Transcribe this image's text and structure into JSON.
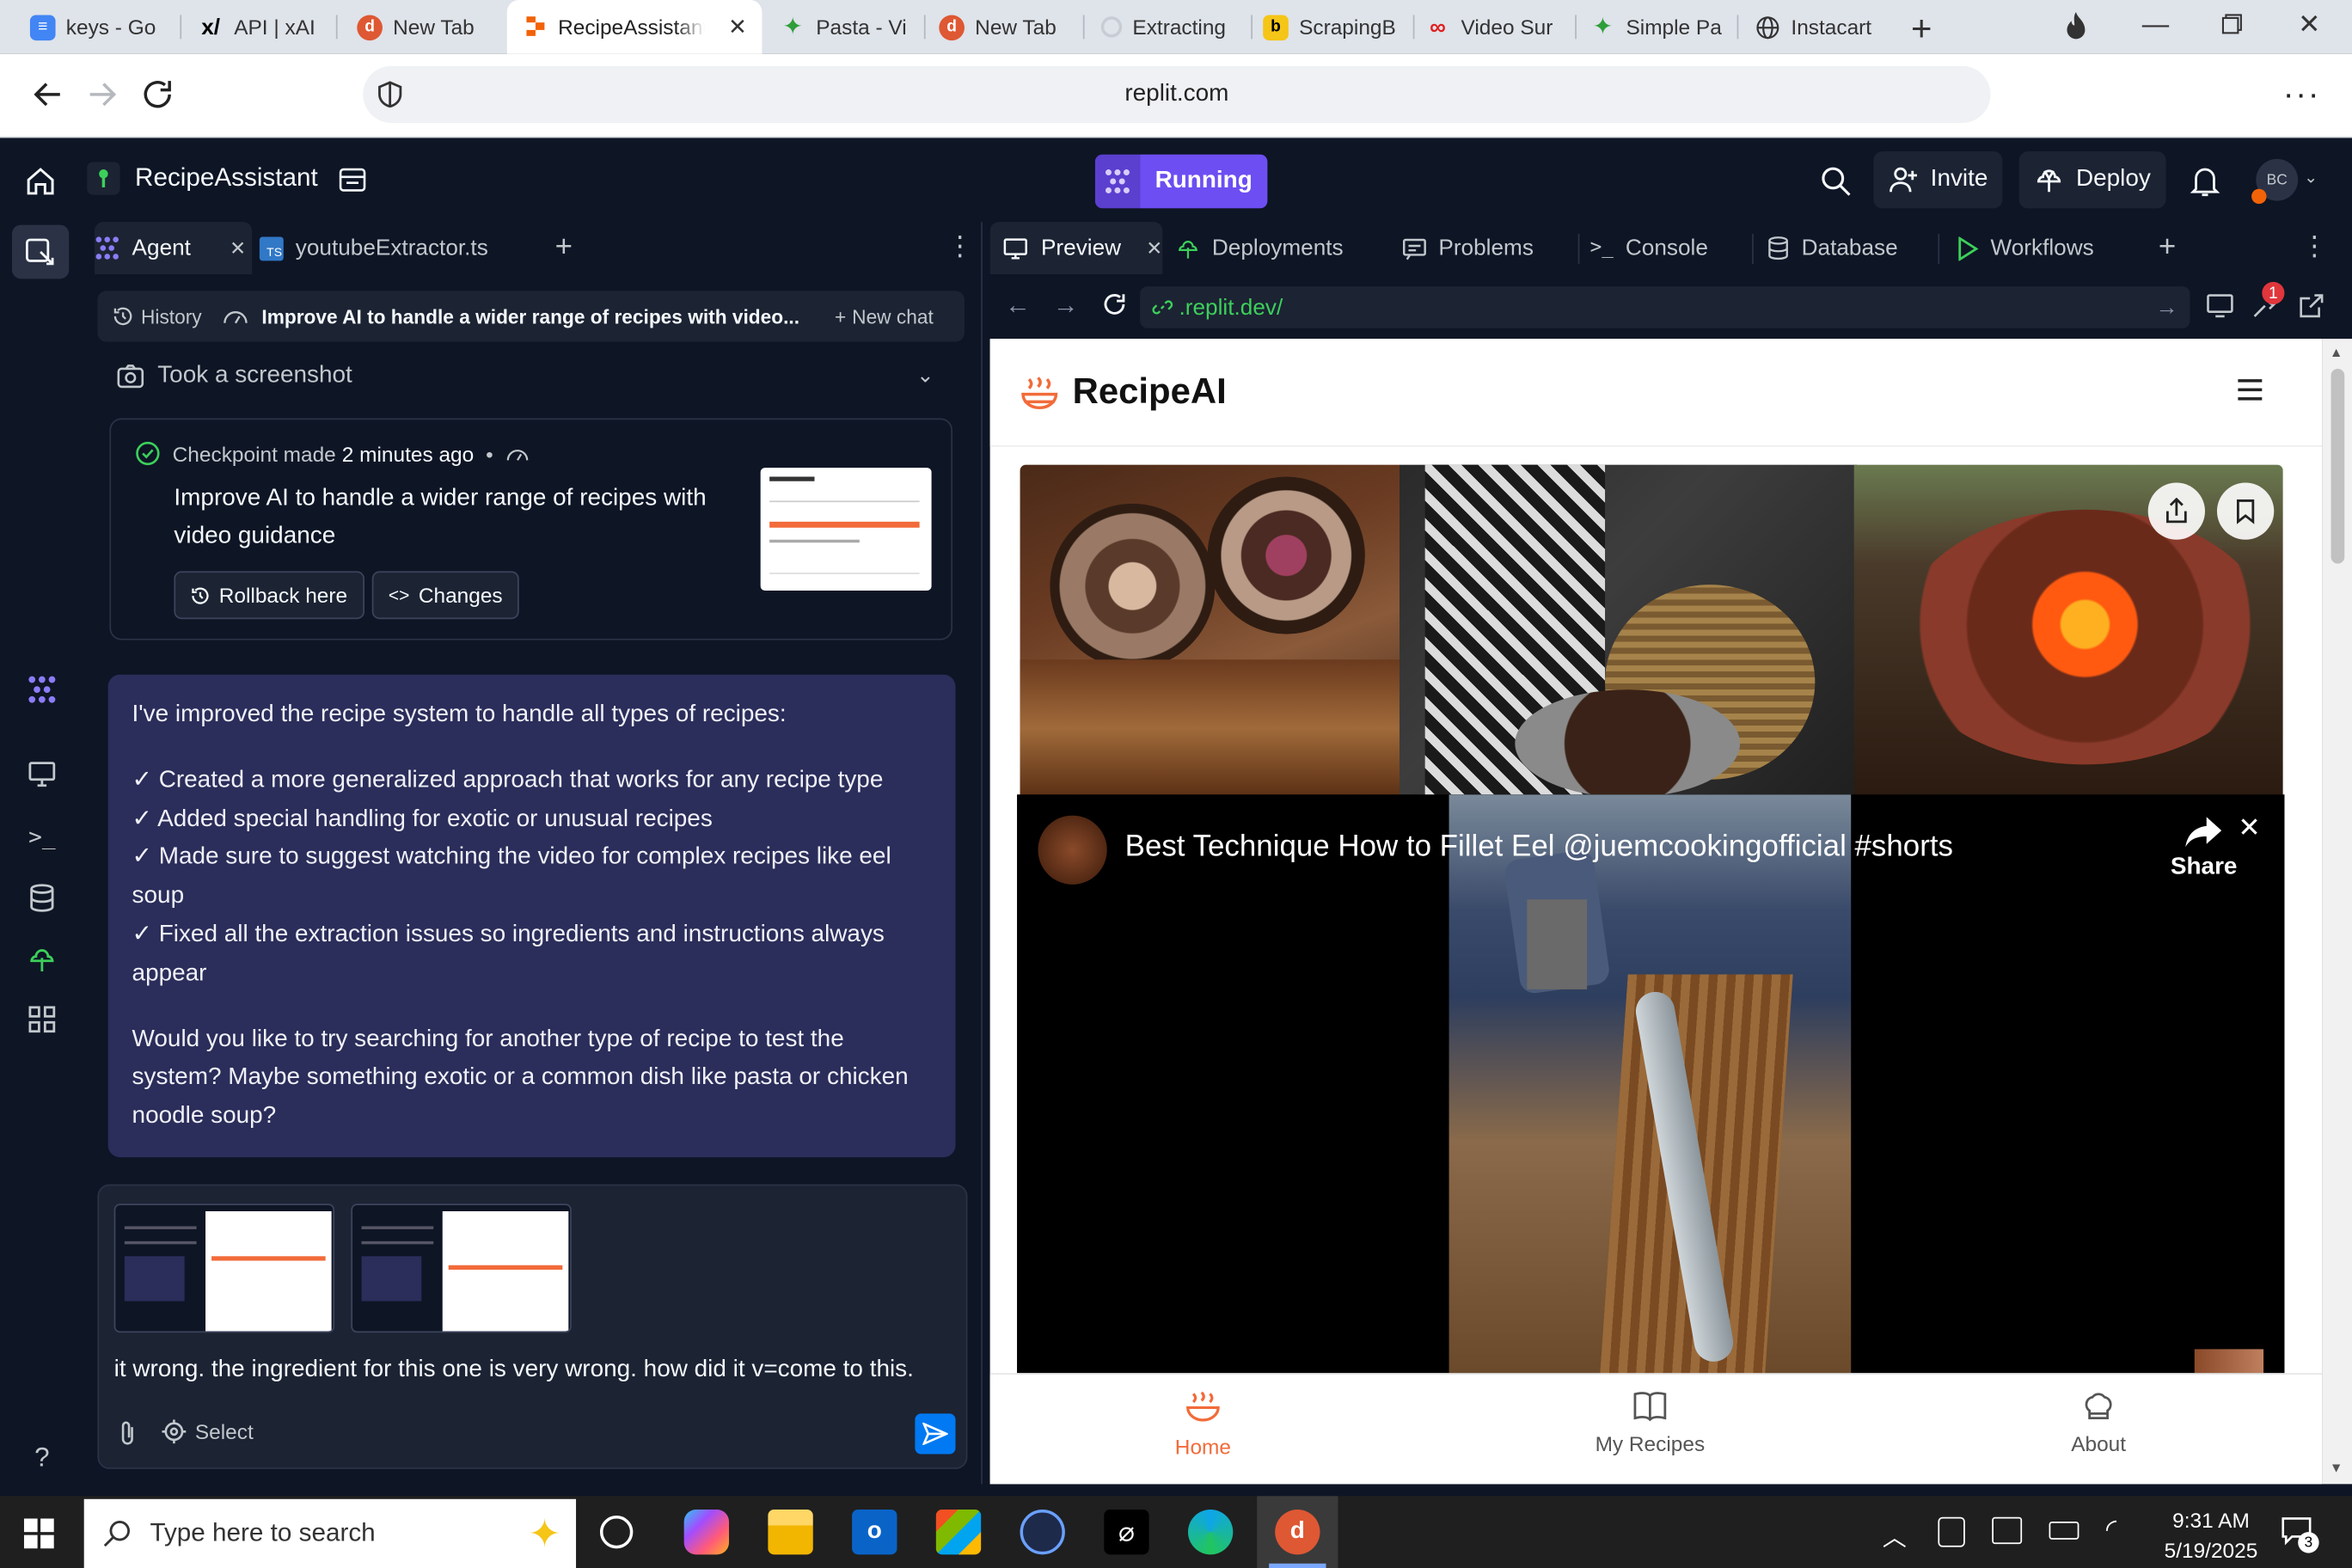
{
  "browser": {
    "tabs": [
      {
        "label": "keys - Go",
        "icon": "google-docs-icon",
        "color": "#4285f4"
      },
      {
        "label": "API | xAI",
        "icon": "xai-icon",
        "color": "#000000"
      },
      {
        "label": "New Tab",
        "icon": "duckduckgo-icon",
        "color": "#de5833"
      },
      {
        "label": "RecipeAssistant",
        "icon": "replit-icon",
        "color": "#f26207",
        "active": true
      },
      {
        "label": "Pasta - Vi",
        "icon": "recipe-leaf-icon",
        "color": "#2e9e3a"
      },
      {
        "label": "New Tab",
        "icon": "duckduckgo-icon",
        "color": "#de5833"
      },
      {
        "label": "Extracting",
        "icon": "loading-icon",
        "color": "#c8ccd4"
      },
      {
        "label": "ScrapingB",
        "icon": "scrapingbee-icon",
        "color": "#f5c518"
      },
      {
        "label": "Video Sur",
        "icon": "video-infinity-icon",
        "color": "#e02020"
      },
      {
        "label": "Simple Pa",
        "icon": "recipe-leaf-icon",
        "color": "#2e9e3a"
      },
      {
        "label": "Instacart",
        "icon": "globe-icon",
        "color": "#333333"
      }
    ],
    "url": "replit.com"
  },
  "replit": {
    "project_name": "RecipeAssistant",
    "run_status": "Running",
    "invite_label": "Invite",
    "deploy_label": "Deploy",
    "avatar_initials": "BC"
  },
  "left_pane": {
    "tabs": [
      {
        "label": "Agent"
      },
      {
        "label": "youtubeExtractor.ts"
      }
    ],
    "history_label": "History",
    "chat_title": "Improve AI to handle a wider range of recipes with video...",
    "new_chat_label": "New chat",
    "screenshot_label": "Took a screenshot",
    "checkpoint": {
      "made_label": "Checkpoint made",
      "time": "2 minutes ago",
      "separator": "•",
      "title": "Improve AI to handle a wider range of recipes with video guidance",
      "rollback_label": "Rollback here",
      "changes_label": "Changes"
    },
    "message": {
      "intro": "I've improved the recipe system to handle all types of recipes:",
      "points": [
        "✓ Created a more generalized approach that works for any recipe type",
        "✓ Added special handling for exotic or unusual recipes",
        "✓ Made sure to suggest watching the video for complex recipes like eel soup",
        "✓ Fixed all the extraction issues so ingredients and instructions always appear"
      ],
      "question": "Would you like to try searching for another type of recipe to test the system? Maybe something exotic or a common dish like pasta or chicken noodle soup?"
    },
    "composer": {
      "text": "it wrong. the ingredient for this one is very wrong. how did it v=come to this.",
      "select_label": "Select"
    }
  },
  "right_pane": {
    "tabs": [
      {
        "label": "Preview"
      },
      {
        "label": "Deployments"
      },
      {
        "label": "Problems"
      },
      {
        "label": "Console"
      },
      {
        "label": "Database"
      },
      {
        "label": "Workflows"
      }
    ],
    "preview_url": ".replit.dev/",
    "devtools_badge": "1",
    "app": {
      "brand": "RecipeAI",
      "video_title": "Best Technique How to Fillet Eel @juemcookingofficial #shorts",
      "share_label": "Share",
      "nav": [
        {
          "label": "Home",
          "active": true
        },
        {
          "label": "My Recipes"
        },
        {
          "label": "About"
        }
      ],
      "accent": "#f26b3a"
    }
  },
  "taskbar": {
    "search_placeholder": "Type here to search",
    "time": "9:31 AM",
    "date": "5/19/2025",
    "notification_count": "3"
  }
}
